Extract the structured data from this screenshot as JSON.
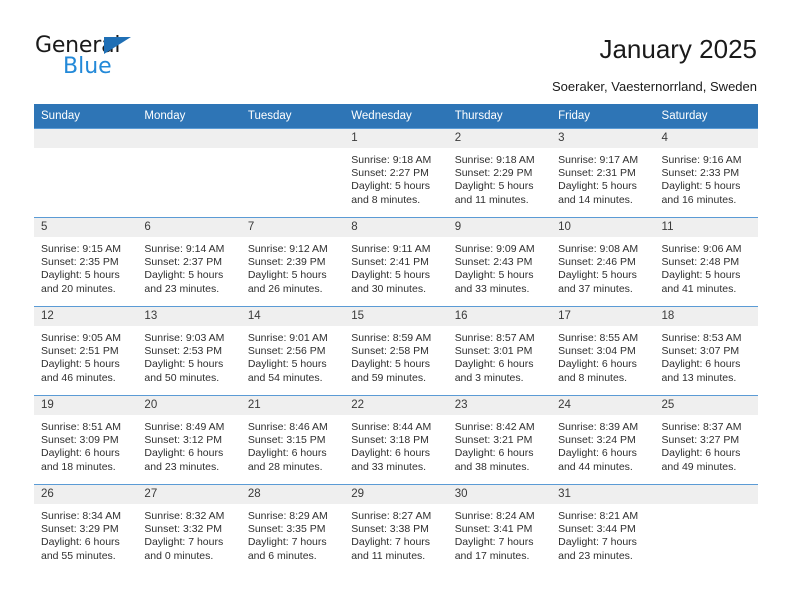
{
  "brand": {
    "name_top": "General",
    "name_bottom": "Blue",
    "triangle_icon": "triangle-icon",
    "color_dark": "#1a1a1a",
    "color_blue": "#2389d8"
  },
  "header": {
    "title": "January 2025",
    "subtitle": "Soeraker, Vaesternorrland, Sweden"
  },
  "theme": {
    "header_bg": "#2e75b6",
    "header_text": "#ffffff",
    "daynum_bg": "#efefef",
    "grid_line": "#5b9bd5",
    "body_text": "#2f2f2f"
  },
  "calendar": {
    "weekday_headers": [
      "Sunday",
      "Monday",
      "Tuesday",
      "Wednesday",
      "Thursday",
      "Friday",
      "Saturday"
    ],
    "weeks": [
      [
        {
          "day": "",
          "lines": []
        },
        {
          "day": "",
          "lines": []
        },
        {
          "day": "",
          "lines": []
        },
        {
          "day": "1",
          "lines": [
            "Sunrise: 9:18 AM",
            "Sunset: 2:27 PM",
            "Daylight: 5 hours",
            "and 8 minutes."
          ]
        },
        {
          "day": "2",
          "lines": [
            "Sunrise: 9:18 AM",
            "Sunset: 2:29 PM",
            "Daylight: 5 hours",
            "and 11 minutes."
          ]
        },
        {
          "day": "3",
          "lines": [
            "Sunrise: 9:17 AM",
            "Sunset: 2:31 PM",
            "Daylight: 5 hours",
            "and 14 minutes."
          ]
        },
        {
          "day": "4",
          "lines": [
            "Sunrise: 9:16 AM",
            "Sunset: 2:33 PM",
            "Daylight: 5 hours",
            "and 16 minutes."
          ]
        }
      ],
      [
        {
          "day": "5",
          "lines": [
            "Sunrise: 9:15 AM",
            "Sunset: 2:35 PM",
            "Daylight: 5 hours",
            "and 20 minutes."
          ]
        },
        {
          "day": "6",
          "lines": [
            "Sunrise: 9:14 AM",
            "Sunset: 2:37 PM",
            "Daylight: 5 hours",
            "and 23 minutes."
          ]
        },
        {
          "day": "7",
          "lines": [
            "Sunrise: 9:12 AM",
            "Sunset: 2:39 PM",
            "Daylight: 5 hours",
            "and 26 minutes."
          ]
        },
        {
          "day": "8",
          "lines": [
            "Sunrise: 9:11 AM",
            "Sunset: 2:41 PM",
            "Daylight: 5 hours",
            "and 30 minutes."
          ]
        },
        {
          "day": "9",
          "lines": [
            "Sunrise: 9:09 AM",
            "Sunset: 2:43 PM",
            "Daylight: 5 hours",
            "and 33 minutes."
          ]
        },
        {
          "day": "10",
          "lines": [
            "Sunrise: 9:08 AM",
            "Sunset: 2:46 PM",
            "Daylight: 5 hours",
            "and 37 minutes."
          ]
        },
        {
          "day": "11",
          "lines": [
            "Sunrise: 9:06 AM",
            "Sunset: 2:48 PM",
            "Daylight: 5 hours",
            "and 41 minutes."
          ]
        }
      ],
      [
        {
          "day": "12",
          "lines": [
            "Sunrise: 9:05 AM",
            "Sunset: 2:51 PM",
            "Daylight: 5 hours",
            "and 46 minutes."
          ]
        },
        {
          "day": "13",
          "lines": [
            "Sunrise: 9:03 AM",
            "Sunset: 2:53 PM",
            "Daylight: 5 hours",
            "and 50 minutes."
          ]
        },
        {
          "day": "14",
          "lines": [
            "Sunrise: 9:01 AM",
            "Sunset: 2:56 PM",
            "Daylight: 5 hours",
            "and 54 minutes."
          ]
        },
        {
          "day": "15",
          "lines": [
            "Sunrise: 8:59 AM",
            "Sunset: 2:58 PM",
            "Daylight: 5 hours",
            "and 59 minutes."
          ]
        },
        {
          "day": "16",
          "lines": [
            "Sunrise: 8:57 AM",
            "Sunset: 3:01 PM",
            "Daylight: 6 hours",
            "and 3 minutes."
          ]
        },
        {
          "day": "17",
          "lines": [
            "Sunrise: 8:55 AM",
            "Sunset: 3:04 PM",
            "Daylight: 6 hours",
            "and 8 minutes."
          ]
        },
        {
          "day": "18",
          "lines": [
            "Sunrise: 8:53 AM",
            "Sunset: 3:07 PM",
            "Daylight: 6 hours",
            "and 13 minutes."
          ]
        }
      ],
      [
        {
          "day": "19",
          "lines": [
            "Sunrise: 8:51 AM",
            "Sunset: 3:09 PM",
            "Daylight: 6 hours",
            "and 18 minutes."
          ]
        },
        {
          "day": "20",
          "lines": [
            "Sunrise: 8:49 AM",
            "Sunset: 3:12 PM",
            "Daylight: 6 hours",
            "and 23 minutes."
          ]
        },
        {
          "day": "21",
          "lines": [
            "Sunrise: 8:46 AM",
            "Sunset: 3:15 PM",
            "Daylight: 6 hours",
            "and 28 minutes."
          ]
        },
        {
          "day": "22",
          "lines": [
            "Sunrise: 8:44 AM",
            "Sunset: 3:18 PM",
            "Daylight: 6 hours",
            "and 33 minutes."
          ]
        },
        {
          "day": "23",
          "lines": [
            "Sunrise: 8:42 AM",
            "Sunset: 3:21 PM",
            "Daylight: 6 hours",
            "and 38 minutes."
          ]
        },
        {
          "day": "24",
          "lines": [
            "Sunrise: 8:39 AM",
            "Sunset: 3:24 PM",
            "Daylight: 6 hours",
            "and 44 minutes."
          ]
        },
        {
          "day": "25",
          "lines": [
            "Sunrise: 8:37 AM",
            "Sunset: 3:27 PM",
            "Daylight: 6 hours",
            "and 49 minutes."
          ]
        }
      ],
      [
        {
          "day": "26",
          "lines": [
            "Sunrise: 8:34 AM",
            "Sunset: 3:29 PM",
            "Daylight: 6 hours",
            "and 55 minutes."
          ]
        },
        {
          "day": "27",
          "lines": [
            "Sunrise: 8:32 AM",
            "Sunset: 3:32 PM",
            "Daylight: 7 hours",
            "and 0 minutes."
          ]
        },
        {
          "day": "28",
          "lines": [
            "Sunrise: 8:29 AM",
            "Sunset: 3:35 PM",
            "Daylight: 7 hours",
            "and 6 minutes."
          ]
        },
        {
          "day": "29",
          "lines": [
            "Sunrise: 8:27 AM",
            "Sunset: 3:38 PM",
            "Daylight: 7 hours",
            "and 11 minutes."
          ]
        },
        {
          "day": "30",
          "lines": [
            "Sunrise: 8:24 AM",
            "Sunset: 3:41 PM",
            "Daylight: 7 hours",
            "and 17 minutes."
          ]
        },
        {
          "day": "31",
          "lines": [
            "Sunrise: 8:21 AM",
            "Sunset: 3:44 PM",
            "Daylight: 7 hours",
            "and 23 minutes."
          ]
        },
        {
          "day": "",
          "lines": []
        }
      ]
    ]
  }
}
